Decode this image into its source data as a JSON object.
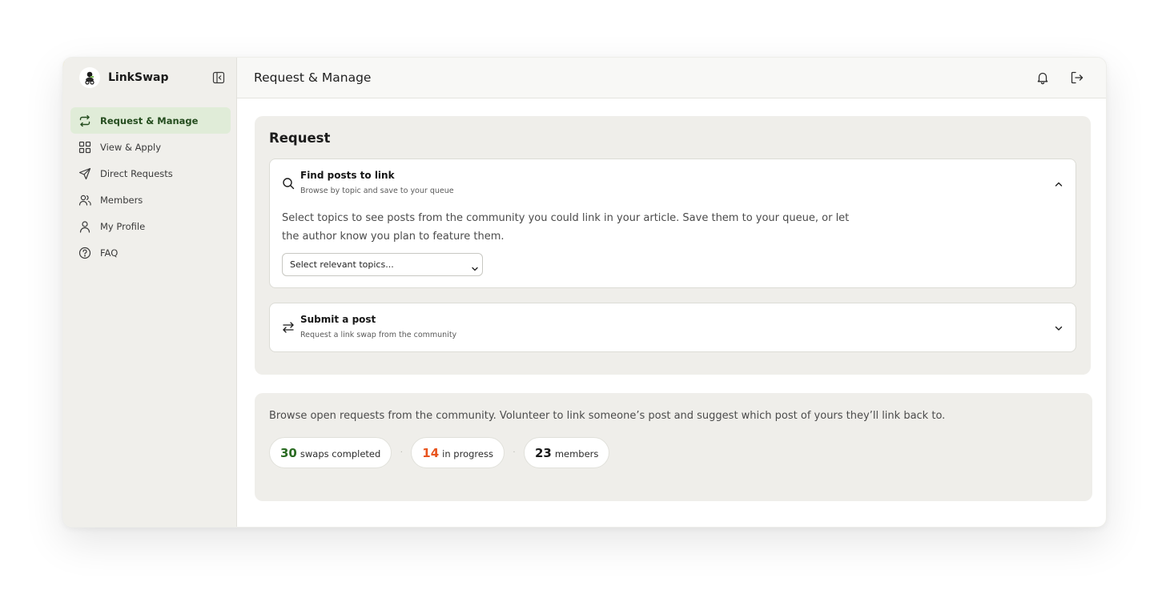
{
  "app": {
    "name": "LinkSwap"
  },
  "sidebar": {
    "items": [
      {
        "label": "Request & Manage",
        "icon": "swap-arrows-icon",
        "active": true
      },
      {
        "label": "View & Apply",
        "icon": "grid-icon",
        "active": false
      },
      {
        "label": "Direct Requests",
        "icon": "send-icon",
        "active": false
      },
      {
        "label": "Members",
        "icon": "users-icon",
        "active": false
      },
      {
        "label": "My Profile",
        "icon": "user-icon",
        "active": false
      },
      {
        "label": "FAQ",
        "icon": "help-circle-icon",
        "active": false
      }
    ]
  },
  "header": {
    "title": "Request & Manage"
  },
  "request": {
    "title": "Request",
    "find": {
      "title": "Find posts to link",
      "subtitle": "Browse by topic and save to your queue",
      "description": "Select topics to see posts from the community you could link in your article. Save them to your queue, or let the author know you plan to feature them.",
      "select_value": "Select relevant topics...",
      "expanded": true
    },
    "submit": {
      "title": "Submit a post",
      "subtitle": "Request a link swap from the community",
      "expanded": false
    }
  },
  "browse": {
    "text": "Browse open requests from the community. Volunteer to link someone’s post and suggest which post of yours they’ll link back to.",
    "stats": [
      {
        "value": "30",
        "label": "swaps completed",
        "color": "#2a6b22"
      },
      {
        "value": "14",
        "label": "in progress",
        "color": "#e8541e"
      },
      {
        "value": "23",
        "label": "members",
        "color": "#1a1a1a"
      }
    ],
    "separator": "·"
  },
  "colors": {
    "accent_green": "#244c1e",
    "active_bg": "#e0ecd8",
    "sidebar_bg": "#f0efeb",
    "panel_bg": "#efeeea"
  }
}
